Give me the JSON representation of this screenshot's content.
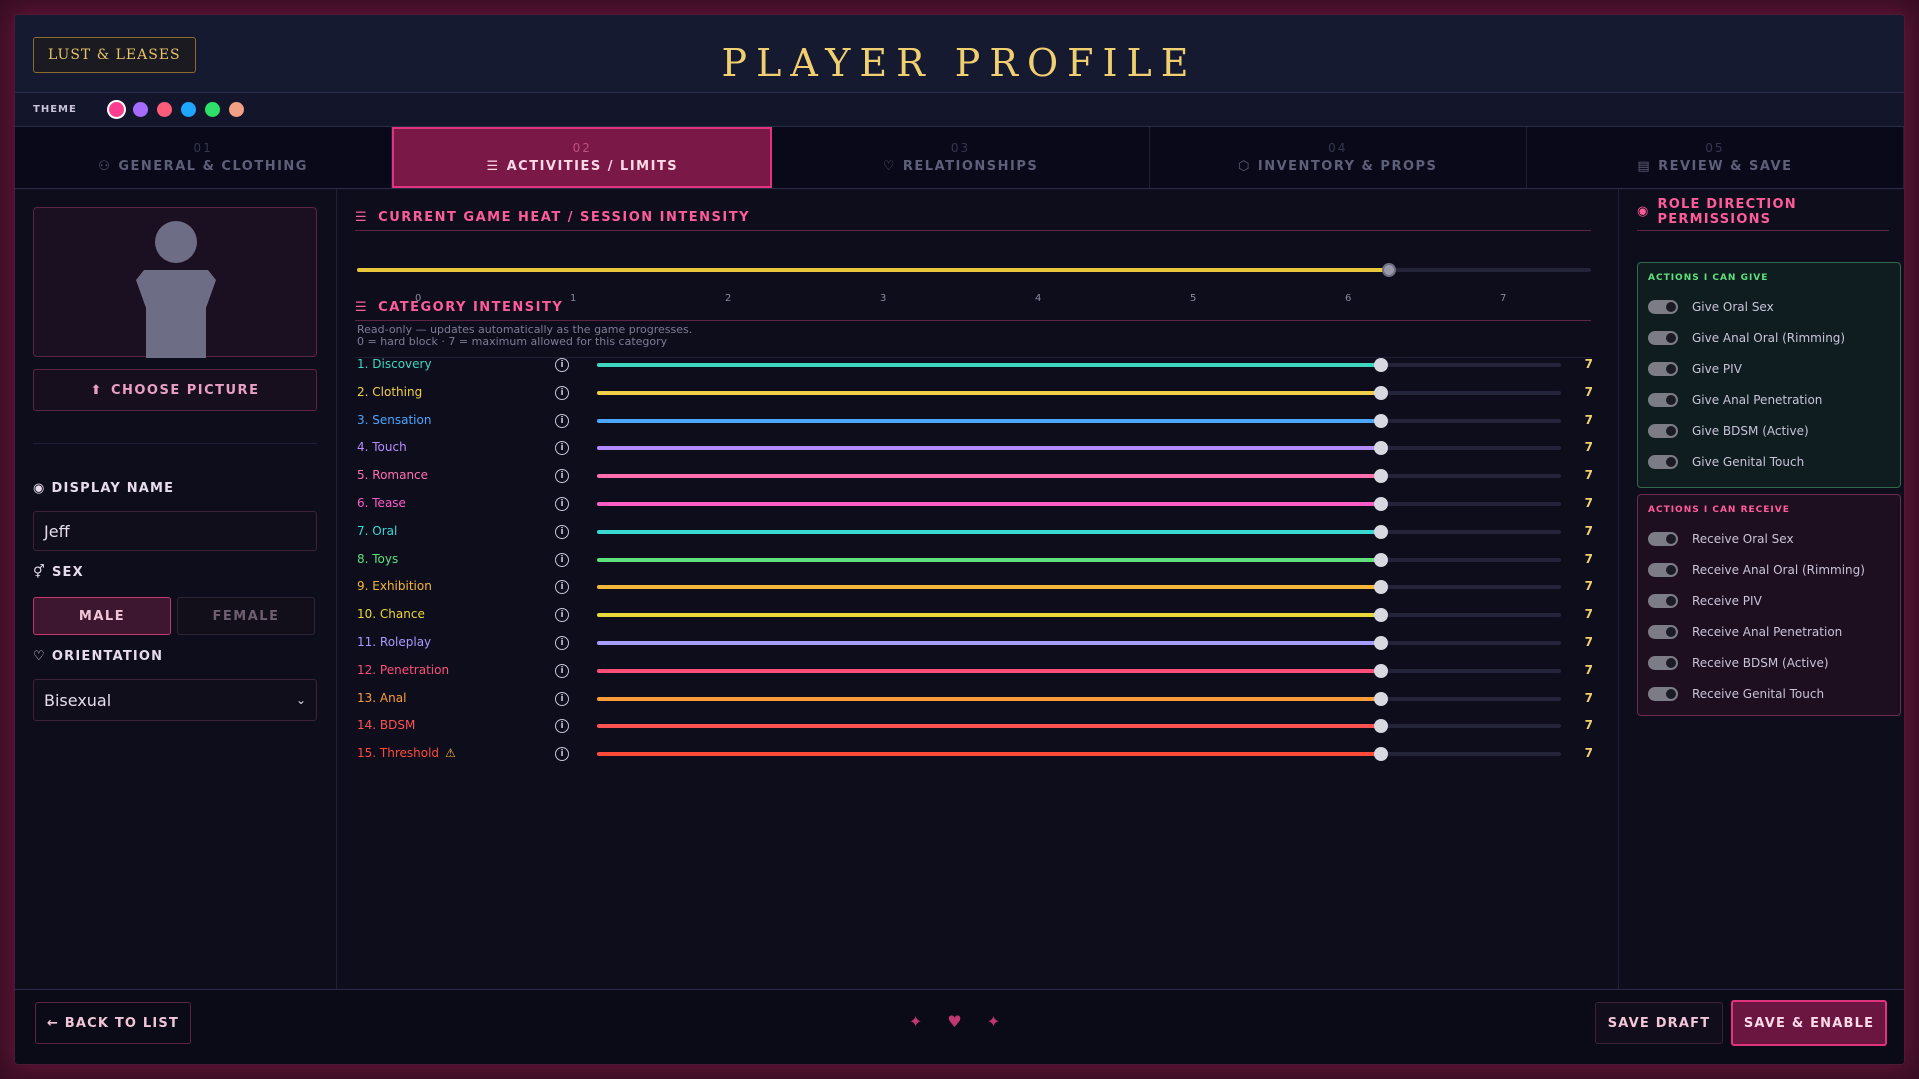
{
  "brand": "LUST & LEASES",
  "title": "PLAYER PROFILE",
  "theme": {
    "label": "THEME",
    "swatches": [
      "#ff3d8f",
      "#a56bff",
      "#ff5c7a",
      "#1ea7ff",
      "#2ee06a",
      "#f0a085"
    ]
  },
  "tabs": [
    {
      "num": "01",
      "label": "GENERAL & CLOTHING",
      "icon": "user-icon"
    },
    {
      "num": "02",
      "label": "ACTIVITIES / LIMITS",
      "icon": "sliders-icon"
    },
    {
      "num": "03",
      "label": "RELATIONSHIPS",
      "icon": "heart-icon"
    },
    {
      "num": "04",
      "label": "INVENTORY & PROPS",
      "icon": "box-icon"
    },
    {
      "num": "05",
      "label": "REVIEW & SAVE",
      "icon": "document-icon"
    }
  ],
  "profile": {
    "choose_picture": "CHOOSE PICTURE",
    "display_name_label": "DISPLAY NAME",
    "display_name": "Jeff",
    "sex_label": "SEX",
    "sex_options": [
      "MALE",
      "FEMALE"
    ],
    "sex_selected": "MALE",
    "orientation_label": "ORIENTATION",
    "orientation": "Bisexual"
  },
  "heat": {
    "title": "CURRENT GAME HEAT / SESSION INTENSITY",
    "value": 6.35,
    "min": 0,
    "max": 7,
    "ticks": [
      "0",
      "1",
      "2",
      "3",
      "4",
      "5",
      "6",
      "7"
    ],
    "note": "Read-only — updates automatically as the game progresses."
  },
  "categories": {
    "title": "CATEGORY INTENSITY",
    "legend": "0 = hard block  ·  7 = maximum allowed for this category",
    "max": 7,
    "items": [
      {
        "label": "1.  Discovery",
        "value": "7",
        "color": "#3fd6c0"
      },
      {
        "label": "2.  Clothing",
        "value": "7",
        "color": "#f2cf48"
      },
      {
        "label": "3.  Sensation",
        "value": "7",
        "color": "#4aa6ff"
      },
      {
        "label": "4.  Touch",
        "value": "7",
        "color": "#b58cff"
      },
      {
        "label": "5.  Romance",
        "value": "7",
        "color": "#ff6fb0"
      },
      {
        "label": "6.  Tease",
        "value": "7",
        "color": "#ff5cc8"
      },
      {
        "label": "7.  Oral",
        "value": "7",
        "color": "#38d9d0"
      },
      {
        "label": "8.  Toys",
        "value": "7",
        "color": "#5ee07a"
      },
      {
        "label": "9.  Exhibition",
        "value": "7",
        "color": "#f5b73a"
      },
      {
        "label": "10.  Chance",
        "value": "7",
        "color": "#e9d83a"
      },
      {
        "label": "11.  Roleplay",
        "value": "7",
        "color": "#a79cff"
      },
      {
        "label": "12.  Penetration",
        "value": "7",
        "color": "#ff4f78"
      },
      {
        "label": "13.  Anal",
        "value": "7",
        "color": "#ff9c3a"
      },
      {
        "label": "14.  BDSM",
        "value": "7",
        "color": "#ff5252"
      },
      {
        "label": "15.  Threshold",
        "value": "7",
        "color": "#ff4a3a",
        "warning": true
      }
    ]
  },
  "permissions": {
    "title": "ROLE DIRECTION PERMISSIONS",
    "give_title": "ACTIONS I CAN GIVE",
    "give": [
      "Give Oral Sex",
      "Give Anal Oral (Rimming)",
      "Give PIV",
      "Give Anal Penetration",
      "Give BDSM (Active)",
      "Give Genital Touch"
    ],
    "receive_title": "ACTIONS I CAN RECEIVE",
    "receive": [
      "Receive Oral Sex",
      "Receive Anal Oral (Rimming)",
      "Receive PIV",
      "Receive Anal Penetration",
      "Receive BDSM (Active)",
      "Receive Genital Touch"
    ],
    "give_color": "#5ee07a",
    "receive_color": "#ff5c9a"
  },
  "footer": {
    "back": "← BACK TO LIST",
    "deco": "✦ ♥ ✦",
    "save_draft": "SAVE DRAFT",
    "save_enable": "SAVE & ENABLE"
  }
}
